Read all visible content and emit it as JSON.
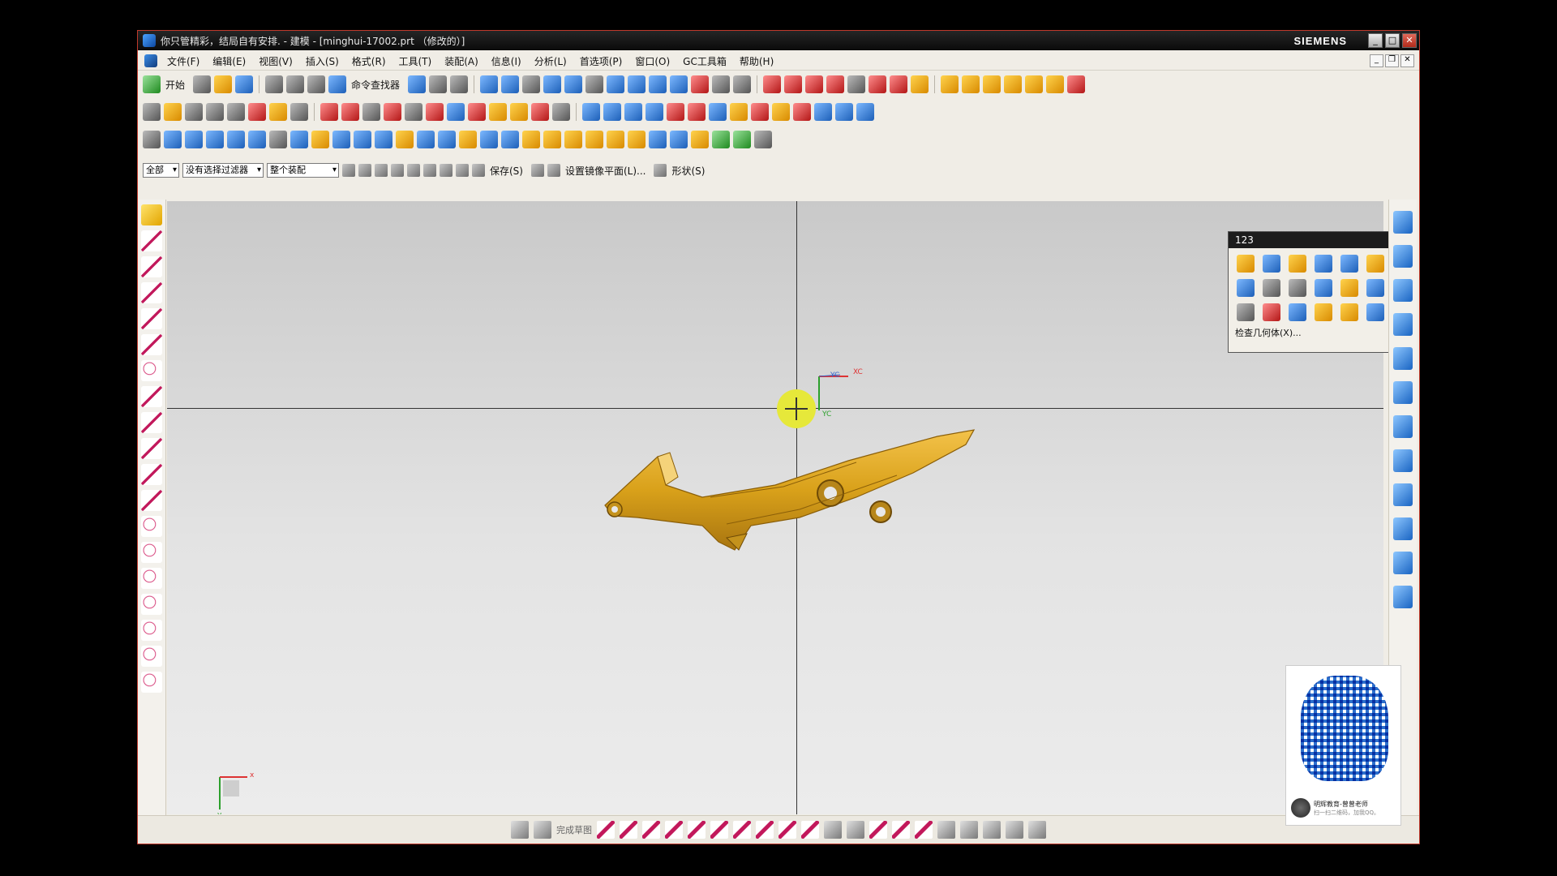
{
  "window": {
    "title": "你只管精彩，结局自有安排. - 建模 - [minghui-17002.prt （修改的）]",
    "brand": "SIEMENS",
    "controls": {
      "minimize": "_",
      "maximize": "□",
      "close": "✕"
    }
  },
  "menu": {
    "items": [
      "文件(F)",
      "编辑(E)",
      "视图(V)",
      "插入(S)",
      "格式(R)",
      "工具(T)",
      "装配(A)",
      "信息(I)",
      "分析(L)",
      "首选项(P)",
      "窗口(O)",
      "GC工具箱",
      "帮助(H)"
    ]
  },
  "toolbar1": {
    "start_label": "开始",
    "command_finder_label": "命令查找器"
  },
  "selection_bar": {
    "scope": "全部",
    "filter": "没有选择过滤器",
    "assembly": "整个装配",
    "save_label": "保存(S)",
    "mirror_plane_label": "设置镜像平面(L)...",
    "shape_label": "形状(S)"
  },
  "palette": {
    "title": "123",
    "footer_label": "检查几何体(X)..."
  },
  "axes": {
    "yc": "YC",
    "xc": "XC",
    "x": "x",
    "y": "y"
  },
  "statusbar": {
    "finish_sketch_label": "完成草图"
  },
  "qr_card": {
    "line1": "明辉教育-曾曾老师",
    "line2": "扫一扫二维码，加我QQ。"
  },
  "colors": {
    "part": "#d9a11a",
    "title_bar": "#1a1a1a",
    "window_border": "#c0392b",
    "viewport_top": "#c9c9c9",
    "viewport_bottom": "#ececec"
  }
}
